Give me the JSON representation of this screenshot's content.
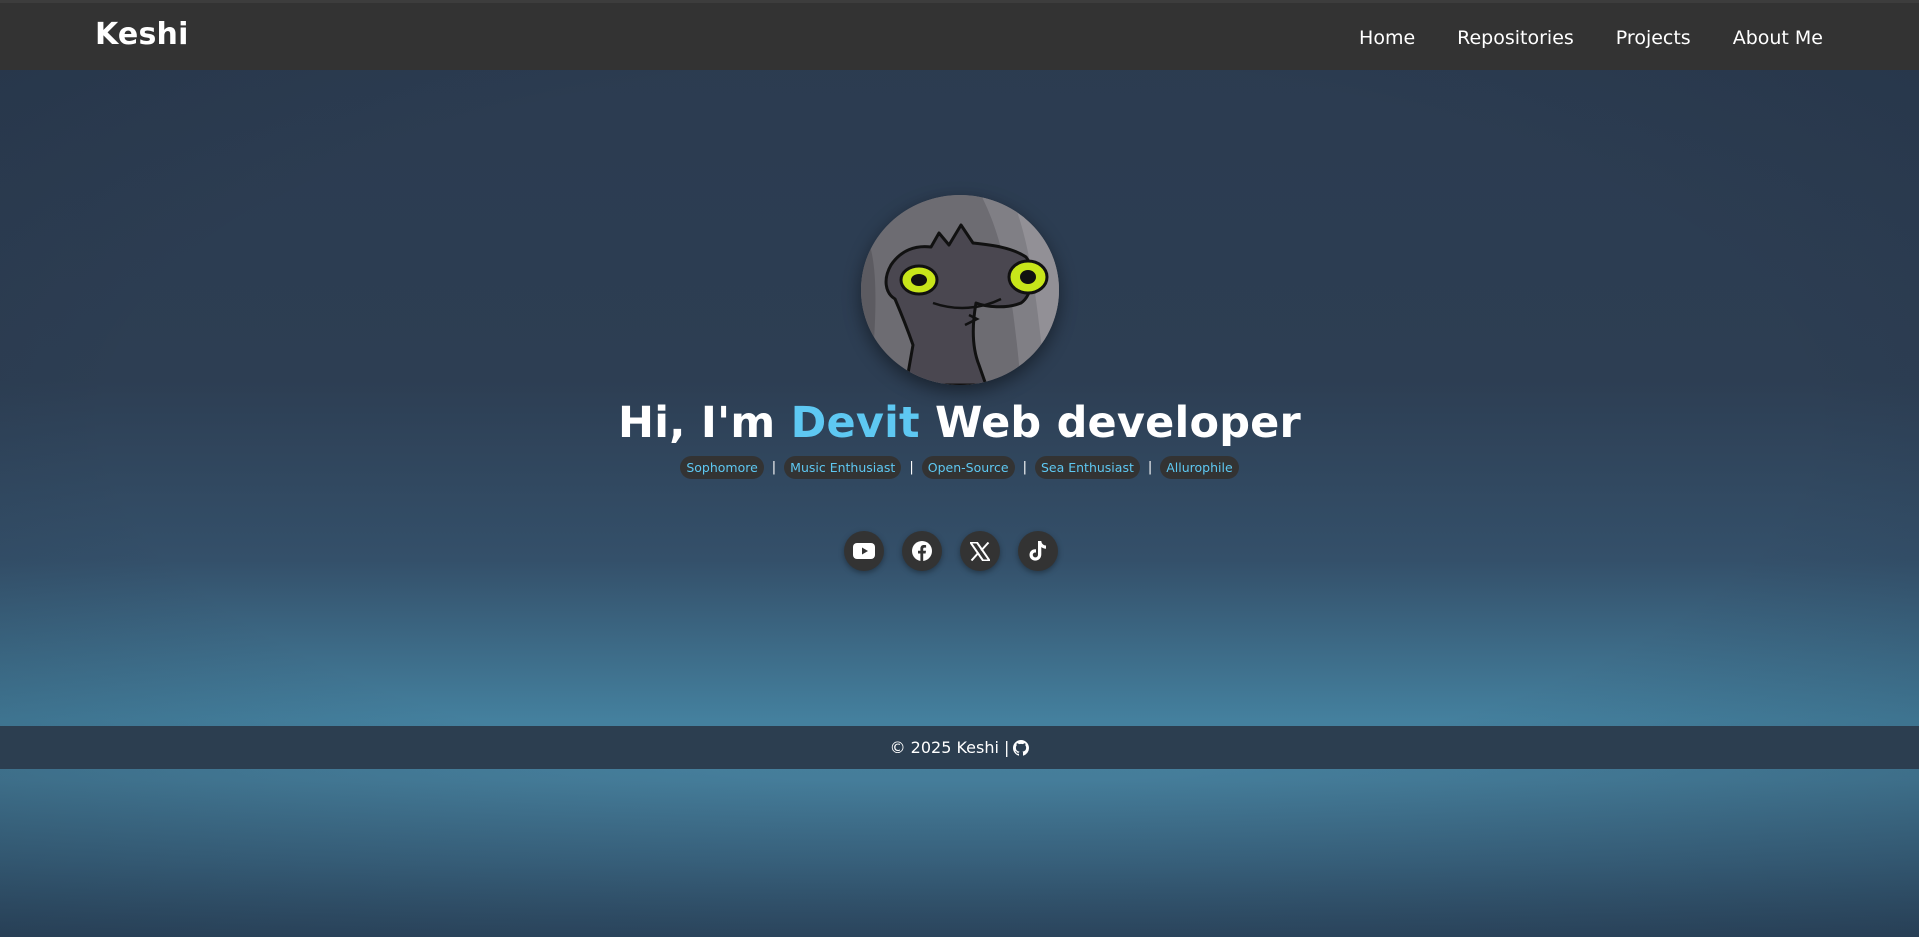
{
  "navbar": {
    "brand": "Keshi",
    "links": [
      {
        "label": "Home"
      },
      {
        "label": "Repositories"
      },
      {
        "label": "Projects"
      },
      {
        "label": "About Me"
      }
    ]
  },
  "hero": {
    "greeting": "Hi, I'm",
    "name": "Devit",
    "role": "Web developer",
    "accent_color": "#5ec8f2",
    "tags": [
      "Sophomore",
      "Music Enthusiast",
      "Open-Source",
      "Sea Enthusiast",
      "Allurophile"
    ],
    "separator": "|",
    "avatar_icon": "cartoon-creature-avatar"
  },
  "socials": [
    {
      "icon": "youtube-icon"
    },
    {
      "icon": "facebook-icon"
    },
    {
      "icon": "x-icon"
    },
    {
      "icon": "tiktok-icon"
    }
  ],
  "footer": {
    "text": "© 2025 Keshi |",
    "icon": "github-icon"
  },
  "colors": {
    "navbar_bg": "#333333",
    "footer_bg": "#2c3e50",
    "accent": "#5ec8f2"
  }
}
